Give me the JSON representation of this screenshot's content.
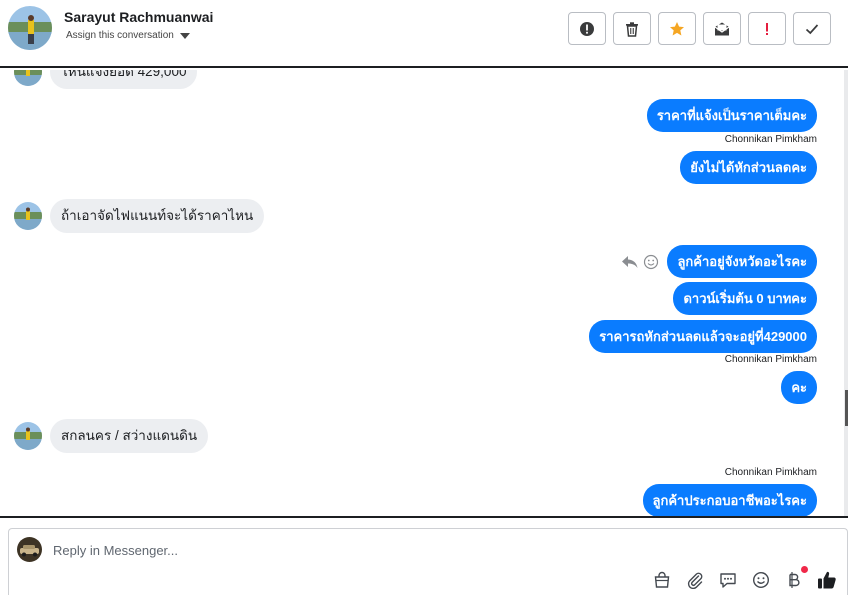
{
  "header": {
    "contact_name": "Sarayut Rachmuanwai",
    "assign_label": "Assign this conversation",
    "actions": [
      "mark-spam",
      "delete",
      "star",
      "mark-unread",
      "flag-important",
      "mark-done"
    ]
  },
  "messages": {
    "m0": "ไหนแจ้งยอด 429,000",
    "m1": "ราคาที่แจ้งเป็นราคาเต็มคะ",
    "m1_sender": "Chonnikan Pimkham",
    "m2": "ยังไม่ได้หักส่วนลดคะ",
    "m3": "ถ้าเอาจัดไฟแนนท์จะได้ราคาไหน",
    "m4": "ลูกค้าอยู่จังหวัดอะไรคะ",
    "m5": "ดาวน์เริ่มต้น 0 บาทคะ",
    "m6": "ราคารถหักส่วนลดแล้วจะอยู่ที่429000",
    "m6_sender": "Chonnikan Pimkham",
    "m7": "คะ",
    "m8": "สกลนคร / สว่างแดนดิน",
    "m9_sender": "Chonnikan Pimkham",
    "m9": "ลูกค้าประกอบอาชีพอะไรคะ"
  },
  "composer": {
    "placeholder": "Reply in Messenger...",
    "tools": [
      "shopping-bag",
      "attachment",
      "saved-replies",
      "emoji",
      "baht-payment",
      "like"
    ]
  },
  "colors": {
    "outgoing_bubble": "#0a7cff",
    "incoming_bubble": "#eceef1",
    "star": "#f5a623",
    "important": "#e41e3f",
    "notification_dot": "#f02849"
  }
}
